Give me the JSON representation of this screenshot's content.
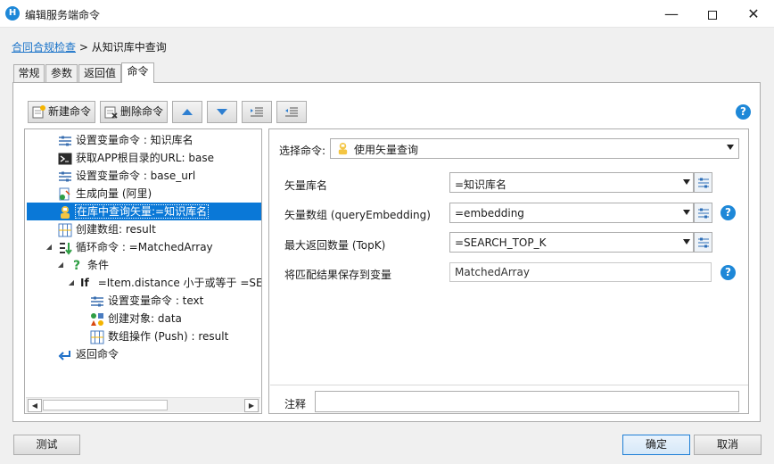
{
  "window": {
    "app_icon_letter": "H",
    "title": "编辑服务端命令",
    "min_label": "—",
    "close_label": "✕"
  },
  "breadcrumb": {
    "link": "合同合规检查",
    "separator": ">",
    "current": "从知识库中查询"
  },
  "tabs": [
    {
      "label": "常规",
      "active": false
    },
    {
      "label": "参数",
      "active": false
    },
    {
      "label": "返回值",
      "active": false
    },
    {
      "label": "命令",
      "active": true
    }
  ],
  "toolbar": {
    "new_label": "新建命令",
    "delete_label": "删除命令",
    "help": "?"
  },
  "tree": {
    "items": [
      {
        "label": "设置变量命令 : 知识库名",
        "icon": "set-variable-icon"
      },
      {
        "label": "获取APP根目录的URL: base",
        "icon": "terminal-icon"
      },
      {
        "label": "设置变量命令 : base_url",
        "icon": "set-variable-icon"
      },
      {
        "label": "生成向量 (阿里)",
        "icon": "vector-icon"
      },
      {
        "label": "在库中查询矢量:=知识库名",
        "icon": "vector-query-icon",
        "selected": true
      },
      {
        "label": "创建数组: result",
        "icon": "array-icon"
      },
      {
        "label": "循环命令 : =MatchedArray",
        "icon": "loop-icon"
      },
      {
        "label": "条件",
        "icon": "condition-icon"
      },
      {
        "label": "=Item.distance 小于或等于 =SEA",
        "icon": "if-icon",
        "if_label": "If"
      },
      {
        "label": "设置变量命令 : text",
        "icon": "set-variable-icon"
      },
      {
        "label": "创建对象: data",
        "icon": "object-icon"
      },
      {
        "label": "数组操作 (Push) : result",
        "icon": "array-icon"
      },
      {
        "label": "返回命令",
        "icon": "return-icon"
      }
    ]
  },
  "detail": {
    "select_label": "选择命令:",
    "select_value": "使用矢量查询",
    "fields": [
      {
        "label": "矢量库名",
        "value": "=知识库名"
      },
      {
        "label": "矢量数组 (queryEmbedding)",
        "value": "=embedding"
      },
      {
        "label": "最大返回数量 (TopK)",
        "value": "=SEARCH_TOP_K"
      },
      {
        "label": "将匹配结果保存到变量",
        "value": "MatchedArray"
      }
    ],
    "note_label": "注释",
    "note_value": ""
  },
  "footer": {
    "test_label": "测试",
    "ok_label": "确定",
    "cancel_label": "取消"
  },
  "colors": {
    "accent": "#0a78d7",
    "link": "#1a73c9",
    "help": "#1e88d8"
  }
}
